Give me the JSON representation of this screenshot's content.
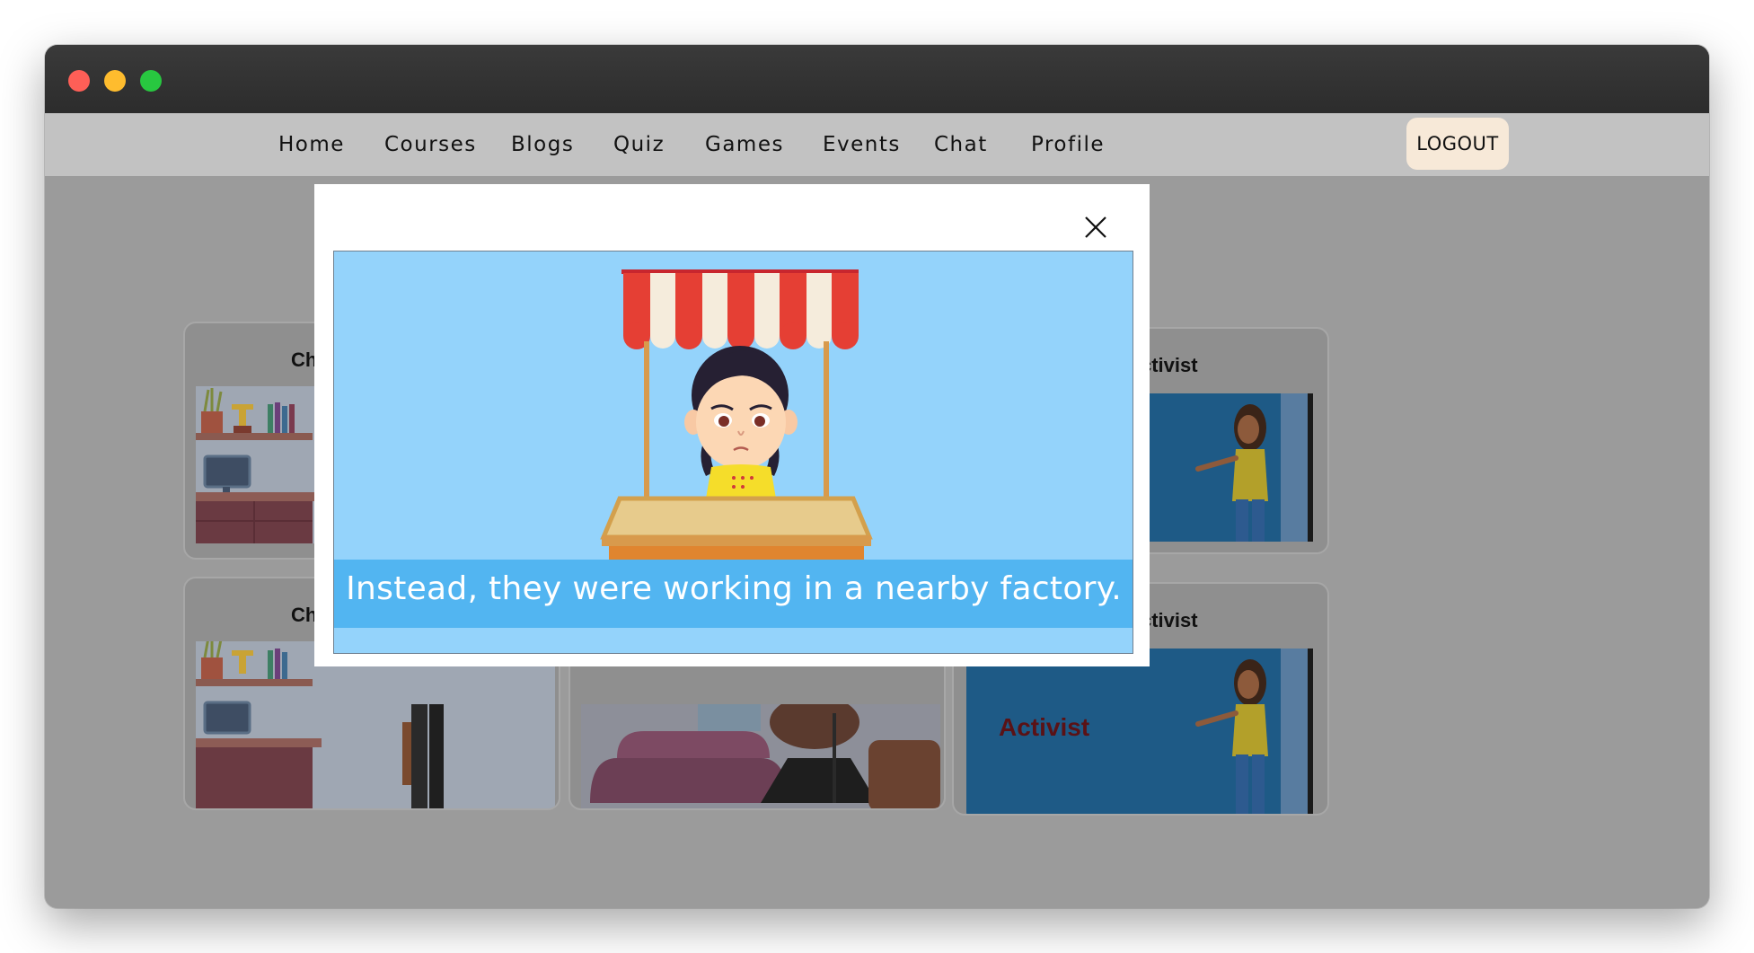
{
  "window": {
    "traffic_lights": [
      "close",
      "minimize",
      "zoom"
    ],
    "colors": {
      "red": "#fe5f57",
      "yellow": "#febc2e",
      "green": "#28c840"
    }
  },
  "nav": {
    "items": [
      {
        "label": "Home"
      },
      {
        "label": "Courses"
      },
      {
        "label": "Blogs"
      },
      {
        "label": "Quiz"
      },
      {
        "label": "Games"
      },
      {
        "label": "Events"
      },
      {
        "label": "Chat"
      },
      {
        "label": "Profile"
      }
    ],
    "logout_label": "LOGOUT"
  },
  "background_cards": {
    "left_title_1": "Child F",
    "left_title_2": "Child F",
    "right_title_1": "ctivist",
    "right_title_2": "ctivist",
    "thumb_caption": "Activist"
  },
  "modal": {
    "close_icon": "close-icon",
    "subtitle": "Instead, they were working in a nearby factory."
  }
}
